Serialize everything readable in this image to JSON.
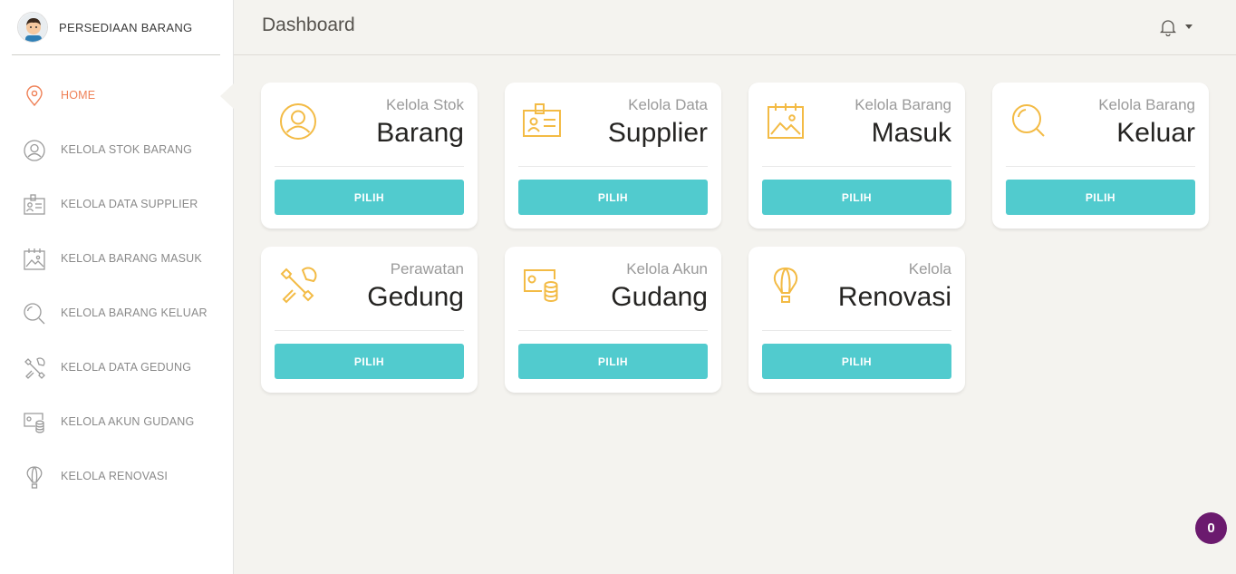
{
  "app": {
    "brand": "PERSEDIAAN BARANG",
    "page_title": "Dashboard"
  },
  "colors": {
    "accent_active": "#ef8157",
    "button": "#51cbce",
    "icon_gold": "#f3bb45",
    "badge": "#6b1a6e"
  },
  "sidebar": {
    "items": [
      {
        "label": "HOME",
        "icon": "location-pin-icon",
        "active": true
      },
      {
        "label": "KELOLA STOK BARANG",
        "icon": "user-circle-icon"
      },
      {
        "label": "KELOLA DATA SUPPLIER",
        "icon": "id-badge-icon"
      },
      {
        "label": "KELOLA BARANG MASUK",
        "icon": "image-calendar-icon"
      },
      {
        "label": "KELOLA BARANG KELUAR",
        "icon": "search-icon"
      },
      {
        "label": "KELOLA DATA GEDUNG",
        "icon": "tools-icon"
      },
      {
        "label": "KELOLA AKUN GUDANG",
        "icon": "money-coins-icon"
      },
      {
        "label": "KELOLA RENOVASI",
        "icon": "air-balloon-icon"
      }
    ]
  },
  "cards": [
    {
      "category": "Kelola Stok",
      "title": "Barang",
      "button": "PILIH",
      "icon": "user-circle-icon"
    },
    {
      "category": "Kelola Data",
      "title": "Supplier",
      "button": "PILIH",
      "icon": "id-badge-icon"
    },
    {
      "category": "Kelola Barang",
      "title": "Masuk",
      "button": "PILIH",
      "icon": "image-calendar-icon"
    },
    {
      "category": "Kelola Barang",
      "title": "Keluar",
      "button": "PILIH",
      "icon": "search-icon"
    },
    {
      "category": "Perawatan",
      "title": "Gedung",
      "button": "PILIH",
      "icon": "tools-icon"
    },
    {
      "category": "Kelola Akun",
      "title": "Gudang",
      "button": "PILIH",
      "icon": "money-coins-icon"
    },
    {
      "category": "Kelola",
      "title": "Renovasi",
      "button": "PILIH",
      "icon": "air-balloon-icon"
    }
  ],
  "notification_badge": {
    "count": "0"
  }
}
